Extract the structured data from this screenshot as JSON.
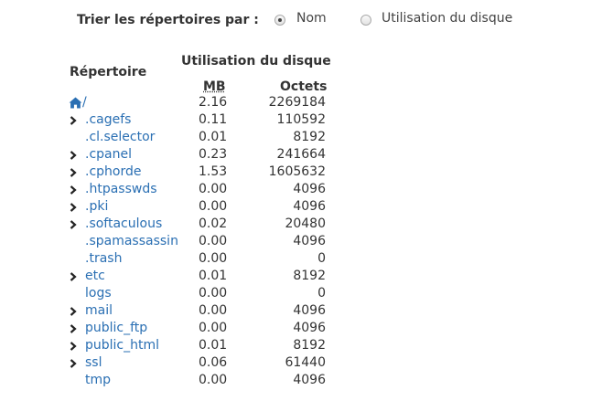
{
  "sort": {
    "label": "Trier les répertoires par :",
    "options": [
      {
        "label": "Nom",
        "checked": true
      },
      {
        "label": "Utilisation du disque",
        "checked": false
      }
    ]
  },
  "table": {
    "header_directory": "Répertoire",
    "header_usage": "Utilisation du disque",
    "header_mb": "MB",
    "header_bytes": "Octets",
    "rows": [
      {
        "name": "/",
        "mb": "2.16",
        "bytes": "2269184",
        "icon": "home-icon",
        "expandable": false
      },
      {
        "name": ".cagefs",
        "mb": "0.11",
        "bytes": "110592",
        "expandable": true
      },
      {
        "name": ".cl.selector",
        "mb": "0.01",
        "bytes": "8192",
        "expandable": false
      },
      {
        "name": ".cpanel",
        "mb": "0.23",
        "bytes": "241664",
        "expandable": true
      },
      {
        "name": ".cphorde",
        "mb": "1.53",
        "bytes": "1605632",
        "expandable": true
      },
      {
        "name": ".htpasswds",
        "mb": "0.00",
        "bytes": "4096",
        "expandable": true
      },
      {
        "name": ".pki",
        "mb": "0.00",
        "bytes": "4096",
        "expandable": true
      },
      {
        "name": ".softaculous",
        "mb": "0.02",
        "bytes": "20480",
        "expandable": true
      },
      {
        "name": ".spamassassin",
        "mb": "0.00",
        "bytes": "4096",
        "expandable": false
      },
      {
        "name": ".trash",
        "mb": "0.00",
        "bytes": "0",
        "expandable": false
      },
      {
        "name": "etc",
        "mb": "0.01",
        "bytes": "8192",
        "expandable": true
      },
      {
        "name": "logs",
        "mb": "0.00",
        "bytes": "0",
        "expandable": false
      },
      {
        "name": "mail",
        "mb": "0.00",
        "bytes": "4096",
        "expandable": true
      },
      {
        "name": "public_ftp",
        "mb": "0.00",
        "bytes": "4096",
        "expandable": true
      },
      {
        "name": "public_html",
        "mb": "0.01",
        "bytes": "8192",
        "expandable": true
      },
      {
        "name": "ssl",
        "mb": "0.06",
        "bytes": "61440",
        "expandable": true
      },
      {
        "name": "tmp",
        "mb": "0.00",
        "bytes": "4096",
        "expandable": false
      }
    ]
  },
  "colors": {
    "link": "#2a6fb3",
    "text": "#333333"
  }
}
